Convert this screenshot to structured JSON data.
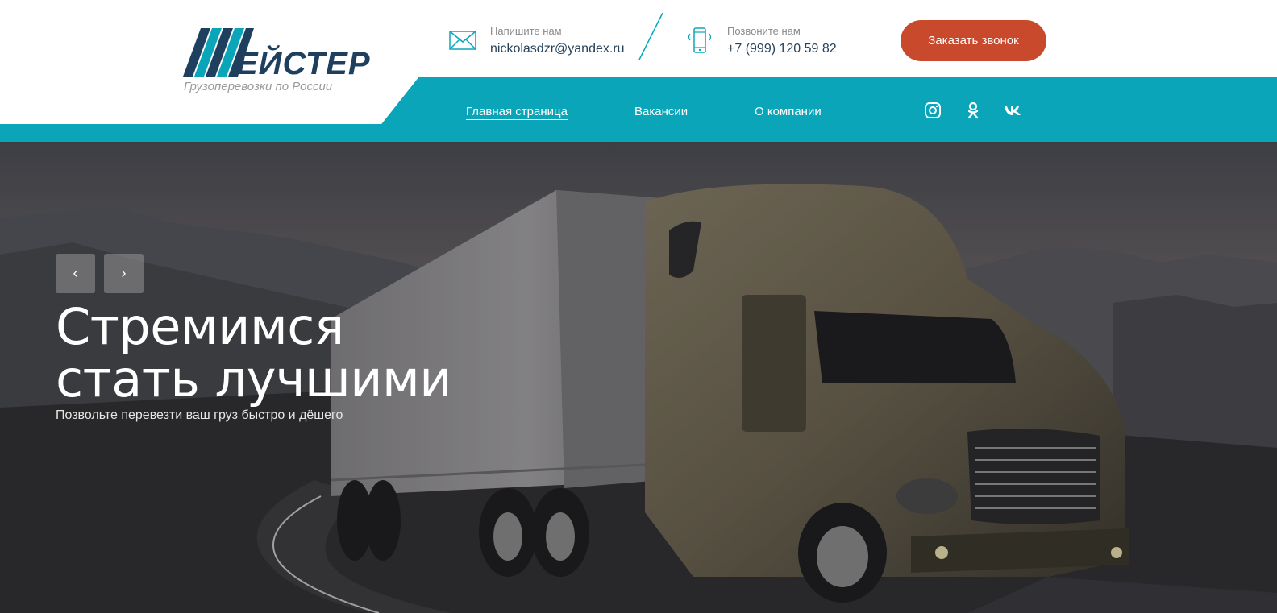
{
  "logo": {
    "word": "ЕЙСТЕР",
    "tagline": "Грузоперевозки по России"
  },
  "contacts": {
    "email": {
      "label": "Напишите нам",
      "value": "nickolasdzr@yandex.ru",
      "icon": "envelope-icon"
    },
    "phone": {
      "label": "Позвоните нам",
      "value": "+7 (999) 120 59 82",
      "icon": "phone-icon"
    }
  },
  "callback_button": {
    "label": "Заказать звонок"
  },
  "nav": {
    "items": [
      {
        "label": "Главная страница",
        "active": true
      },
      {
        "label": "Вакансии",
        "active": false
      },
      {
        "label": "О компании",
        "active": false
      }
    ]
  },
  "social": [
    "instagram-icon",
    "odnoklassniki-icon",
    "vk-icon"
  ],
  "hero": {
    "prev_label": "‹",
    "next_label": "›",
    "title_line1": "Стремимся",
    "title_line2": "стать лучшими",
    "subtitle": "Позвольте перевезти ваш груз быстро и дёшего"
  },
  "colors": {
    "teal": "#0aa5b8",
    "navy": "#1f3f5f",
    "accent": "#c8492b"
  }
}
